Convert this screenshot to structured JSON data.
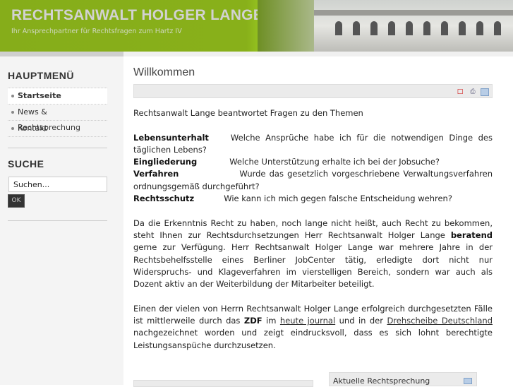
{
  "header": {
    "title": "RECHTSANWALT HOLGER LANGE",
    "subtitle": "Ihr Ansprechpartner für Rechtsfragen zum Hartz IV"
  },
  "sidebar": {
    "menu_title": "HAUPTMENÜ",
    "menu": [
      {
        "label": "Startseite",
        "active": true
      },
      {
        "label": "News & Rechtsprechung"
      },
      {
        "label": "Kontakt"
      }
    ],
    "search_title": "SUCHE",
    "search_value": "Suchen...",
    "search_button": "OK"
  },
  "main": {
    "title": "Willkommen",
    "intro": "Rechtsanwalt Lange beantwortet Fragen zu den Themen",
    "topics": [
      {
        "term": "Lebensunterhalt",
        "text": "Welche Ansprüche habe ich für die notwendigen Dinge des täglichen Lebens?"
      },
      {
        "term": "Eingliederung",
        "text": "Welche Unterstützung erhalte ich bei der Jobsuche?"
      },
      {
        "term": "Verfahren",
        "text": "Wurde das gesetzlich vorgeschriebene Verwaltungsverfahren ordnungsgemäß durchgeführt?"
      },
      {
        "term": "Rechtsschutz",
        "text": "Wie kann ich mich gegen falsche Entscheidung wehren?"
      }
    ],
    "p2a": "Da die Erkenntnis Recht zu haben, noch lange nicht heißt, auch Recht zu bekommen, steht Ihnen zur Rechtsdurchsetzungen Herr Rechtsanwalt Holger Lange ",
    "p2b": "beratend",
    "p2c": " gerne zur Verfügung. Herr Rechtsanwalt Holger Lange war mehrere Jahre in der Rechtsbehelfsstelle eines Berliner JobCenter tätig, erledigte dort nicht nur Widerspruchs- und Klageverfahren im vierstelligen Bereich, sondern war auch als Dozent aktiv an der Weiterbildung der Mitarbeiter beteiligt.",
    "p3a": "Einen der vielen von Herrn Rechtsanwalt Holger Lange erfolgreich durchgesetzten Fälle ist mittlerweile durch das ",
    "p3b": "ZDF",
    "p3c": " im ",
    "link1": "heute journal",
    "p3d": " und in der ",
    "link2": "Drehscheibe Deutschland",
    "p3e": " nachgezeichnet worden und zeigt eindrucksvoll, dass es sich lohnt berechtigte Leistungsanspüche durchzusetzen.",
    "box2_title": "Aktuelle Rechtsprechung"
  }
}
